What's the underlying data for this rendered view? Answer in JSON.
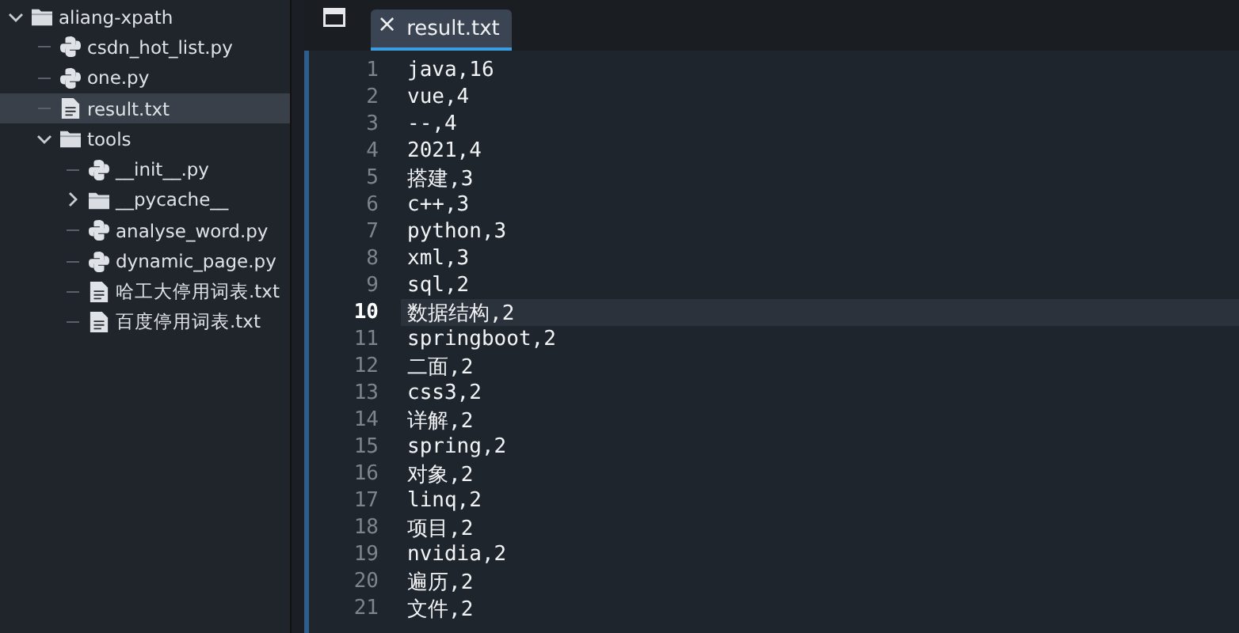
{
  "sidebar": {
    "tree": [
      {
        "kind": "folder",
        "label": "aliang-xpath",
        "expanded": true,
        "selected": false,
        "children": [
          {
            "kind": "python",
            "label": "csdn_hot_list.py",
            "selected": false
          },
          {
            "kind": "python",
            "label": "one.py",
            "selected": false
          },
          {
            "kind": "text",
            "label": "result.txt",
            "selected": true
          },
          {
            "kind": "folder",
            "label": "tools",
            "expanded": true,
            "selected": false,
            "children": [
              {
                "kind": "python",
                "label": "__init__.py",
                "selected": false
              },
              {
                "kind": "folder",
                "label": "__pycache__",
                "expanded": false,
                "selected": false
              },
              {
                "kind": "python",
                "label": "analyse_word.py",
                "selected": false
              },
              {
                "kind": "python",
                "label": "dynamic_page.py",
                "selected": false
              },
              {
                "kind": "text",
                "label": "哈工大停用词表.txt",
                "selected": false
              },
              {
                "kind": "text",
                "label": "百度停用词表.txt",
                "selected": false
              }
            ]
          }
        ]
      }
    ]
  },
  "tabs": [
    {
      "label": "result.txt",
      "close": "×",
      "selected": true
    }
  ],
  "editor": {
    "lines": [
      {
        "number": "1",
        "text": "java,16",
        "current": false
      },
      {
        "number": "2",
        "text": "vue,4",
        "current": false
      },
      {
        "number": "3",
        "text": "--,4",
        "current": false
      },
      {
        "number": "4",
        "text": "2021,4",
        "current": false
      },
      {
        "number": "5",
        "text": "搭建,3",
        "current": false
      },
      {
        "number": "6",
        "text": "c++,3",
        "current": false
      },
      {
        "number": "7",
        "text": "python,3",
        "current": false
      },
      {
        "number": "8",
        "text": "xml,3",
        "current": false
      },
      {
        "number": "9",
        "text": "sql,2",
        "current": false
      },
      {
        "number": "10",
        "text": "数据结构,2",
        "current": true
      },
      {
        "number": "11",
        "text": "springboot,2",
        "current": false
      },
      {
        "number": "12",
        "text": "二面,2",
        "current": false
      },
      {
        "number": "13",
        "text": "css3,2",
        "current": false
      },
      {
        "number": "14",
        "text": "详解,2",
        "current": false
      },
      {
        "number": "15",
        "text": "spring,2",
        "current": false
      },
      {
        "number": "16",
        "text": "对象,2",
        "current": false
      },
      {
        "number": "17",
        "text": "linq,2",
        "current": false
      },
      {
        "number": "18",
        "text": "项目,2",
        "current": false
      },
      {
        "number": "19",
        "text": "nvidia,2",
        "current": false
      },
      {
        "number": "20",
        "text": "遍历,2",
        "current": false
      },
      {
        "number": "21",
        "text": "文件,2",
        "current": false
      }
    ]
  }
}
